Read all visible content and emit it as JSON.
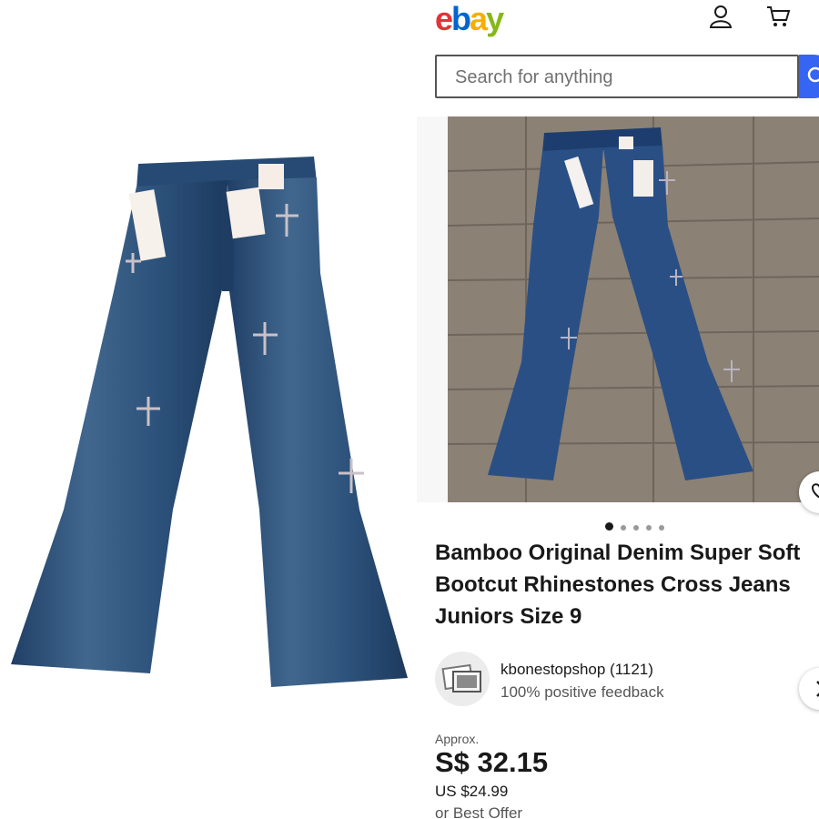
{
  "header": {
    "logo_letters": [
      "e",
      "b",
      "a",
      "y"
    ],
    "logo_colors": [
      "#e53238",
      "#0064d2",
      "#f5af02",
      "#86b817"
    ],
    "icons": [
      "user-icon",
      "cart-icon"
    ]
  },
  "search": {
    "placeholder": "Search for anything",
    "icon": "search-icon"
  },
  "gallery": {
    "image_count": 5,
    "active_index": 0
  },
  "listing": {
    "title_lines": [
      "Bamboo Original Denim Super Soft",
      "Bootcut Rhinestones Cross Jeans",
      "Juniors Size 9"
    ],
    "seller": {
      "name": "kbonestopshop (1121)",
      "feedback": "100% positive feedback"
    },
    "price": {
      "approx_label": "Approx.",
      "value": "S$ 32.15",
      "usd": "US $24.99",
      "offer": "or Best Offer"
    }
  },
  "colors": {
    "accent": "#3665f3",
    "text": "#191919",
    "muted": "#707070"
  }
}
